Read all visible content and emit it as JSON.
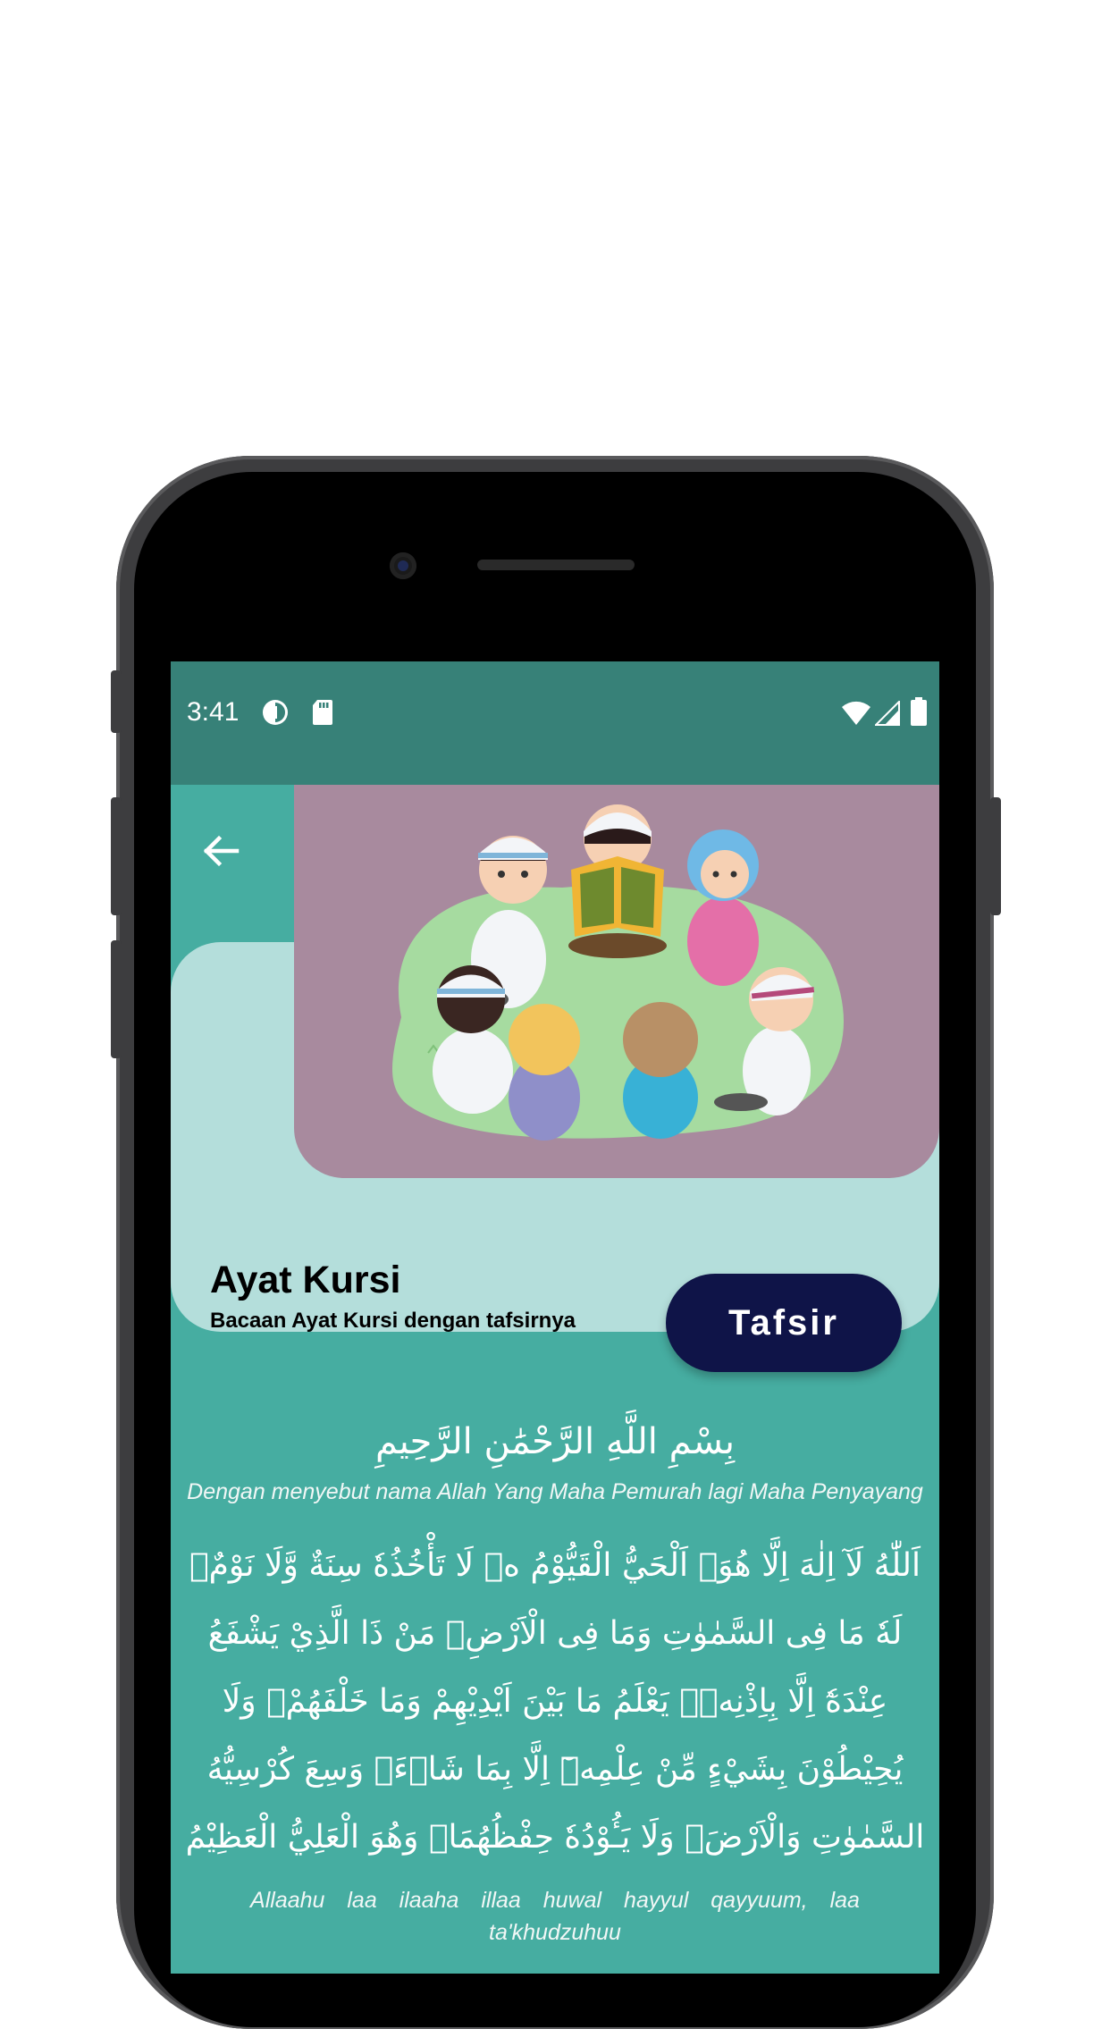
{
  "status_bar": {
    "time": "3:41",
    "icons": [
      "data-saver-icon",
      "sd-card-icon",
      "wifi-icon",
      "cell-signal-icon",
      "battery-icon"
    ]
  },
  "header": {
    "title": "Ayat Kursi",
    "subtitle": "Bacaan Ayat Kursi dengan tafsirnya",
    "tafsir_button_label": "Tafsir",
    "back_icon": "arrow-back-icon",
    "illustration": "children-reading-quran-illustration"
  },
  "content": {
    "basmalah": "بِسْمِ اللَّهِ الرَّحْمَٰنِ الرَّحِيمِ",
    "basmalah_translation": "Dengan menyebut nama Allah Yang Maha Pemurah lagi Maha Penyayang",
    "arabic_verse": "اَللّٰهُ لَآ اِلٰهَ اِلَّا هُوَۚ اَلْحَيُّ الْقَيُّوْمُ ەۚ لَا تَأْخُذُهٗ سِنَةٌ وَّلَا نَوْمٌۗ لَهٗ مَا فِى السَّمٰوٰتِ وَمَا فِى الْاَرْضِۗ مَنْ ذَا الَّذِيْ يَشْفَعُ عِنْدَهٗٓ اِلَّا بِاِذْنِهٖۗ يَعْلَمُ مَا بَيْنَ اَيْدِيْهِمْ وَمَا خَلْفَهُمْۚ وَلَا يُحِيْطُوْنَ بِشَيْءٍ مِّنْ عِلْمِهٖٓ اِلَّا بِمَا شَاۤءَۚ وَسِعَ كُرْسِيُّهُ السَّمٰوٰتِ وَالْاَرْضَۚ وَلَا يَـُٔوْدُهٗ حِفْظُهُمَاۚ وَهُوَ الْعَلِيُّ الْعَظِيْمُ",
    "latin_verse": "Allaahu laa ilaaha illaa huwal hayyul qayyuum, laa ta'khudzuhuu"
  },
  "colors": {
    "status_bar": "#378178",
    "screen_bg": "#46ada1",
    "card_bg": "#b4dedb",
    "image_bg": "#a88a9e",
    "button_bg": "#0f1448"
  }
}
